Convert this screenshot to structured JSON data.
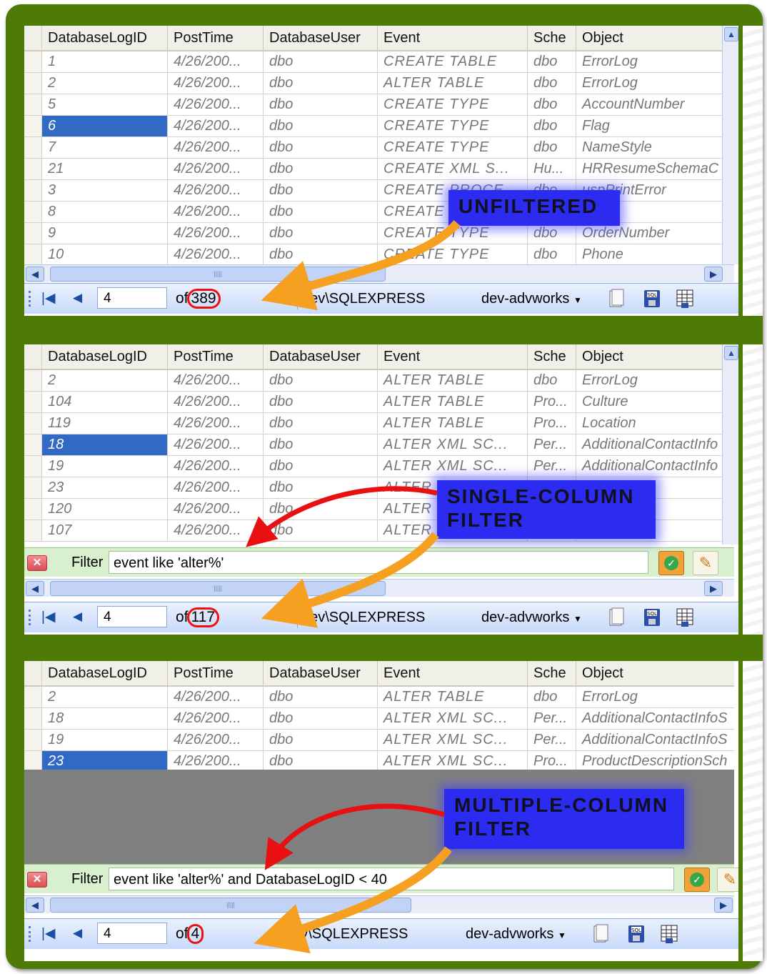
{
  "columns": [
    "DatabaseLogID",
    "PostTime",
    "DatabaseUser",
    "Event",
    "Sche",
    "Object"
  ],
  "panels": {
    "unfiltered": {
      "rows": [
        [
          "1",
          "4/26/200...",
          "dbo",
          "CREATE TABLE",
          "dbo",
          "ErrorLog"
        ],
        [
          "2",
          "4/26/200...",
          "dbo",
          "ALTER TABLE",
          "dbo",
          "ErrorLog"
        ],
        [
          "5",
          "4/26/200...",
          "dbo",
          "CREATE TYPE",
          "dbo",
          "AccountNumber"
        ],
        [
          "6",
          "4/26/200...",
          "dbo",
          "CREATE TYPE",
          "dbo",
          "Flag"
        ],
        [
          "7",
          "4/26/200...",
          "dbo",
          "CREATE TYPE",
          "dbo",
          "NameStyle"
        ],
        [
          "21",
          "4/26/200...",
          "dbo",
          "CREATE XML S...",
          "Hu...",
          "HRResumeSchemaC"
        ],
        [
          "3",
          "4/26/200...",
          "dbo",
          "CREATE PROCE...",
          "dbo",
          "uspPrintError"
        ],
        [
          "8",
          "4/26/200...",
          "dbo",
          "CREATE",
          "",
          ""
        ],
        [
          "9",
          "4/26/200...",
          "dbo",
          "CREATE TYPE",
          "dbo",
          "OrderNumber"
        ],
        [
          "10",
          "4/26/200...",
          "dbo",
          "CREATE TYPE",
          "dbo",
          "Phone"
        ]
      ],
      "position": "4",
      "total": "389",
      "callout": "Unfiltered"
    },
    "single": {
      "rows": [
        [
          "2",
          "4/26/200...",
          "dbo",
          "ALTER TABLE",
          "dbo",
          "ErrorLog"
        ],
        [
          "104",
          "4/26/200...",
          "dbo",
          "ALTER TABLE",
          "Pro...",
          "Culture"
        ],
        [
          "119",
          "4/26/200...",
          "dbo",
          "ALTER TABLE",
          "Pro...",
          "Location"
        ],
        [
          "18",
          "4/26/200...",
          "dbo",
          "ALTER XML SC...",
          "Per...",
          "AdditionalContactInfo"
        ],
        [
          "19",
          "4/26/200...",
          "dbo",
          "ALTER XML SC...",
          "Per...",
          "AdditionalContactInfo"
        ],
        [
          "23",
          "4/26/200...",
          "dbo",
          "ALTER",
          "",
          "scriptionSc"
        ],
        [
          "120",
          "4/26/200...",
          "dbo",
          "ALTER",
          "",
          ""
        ],
        [
          "107",
          "4/26/200...",
          "dbo",
          "ALTER",
          "",
          ""
        ]
      ],
      "filter_label": "Filter",
      "filter_value": "event like 'alter%'",
      "position": "4",
      "total": "117",
      "callout_line1": "Single-Column",
      "callout_line2": "Filter"
    },
    "multi": {
      "rows": [
        [
          "2",
          "4/26/200...",
          "dbo",
          "ALTER TABLE",
          "dbo",
          "ErrorLog"
        ],
        [
          "18",
          "4/26/200...",
          "dbo",
          "ALTER XML SC...",
          "Per...",
          "AdditionalContactInfoS"
        ],
        [
          "19",
          "4/26/200...",
          "dbo",
          "ALTER XML SC...",
          "Per...",
          "AdditionalContactInfoS"
        ],
        [
          "23",
          "4/26/200...",
          "dbo",
          "ALTER XML SC...",
          "Pro...",
          "ProductDescriptionSch"
        ]
      ],
      "filter_label": "Filter",
      "filter_value": "event like 'alter%' and DatabaseLogID < 40",
      "position": "4",
      "total": "4",
      "callout_line1": "Multiple-Column",
      "callout_line2": "Filter"
    }
  },
  "navigator": {
    "of_label": "of",
    "server": "dev\\SQLEXPRESS",
    "database": "dev-advworks",
    "sql_icon_label": "SQL"
  },
  "colors": {
    "frame": "#4e7a06",
    "callout": "#2c2bf0",
    "arrow_orange": "#f5a020",
    "arrow_red": "#e81010",
    "selection": "#316ac5"
  }
}
